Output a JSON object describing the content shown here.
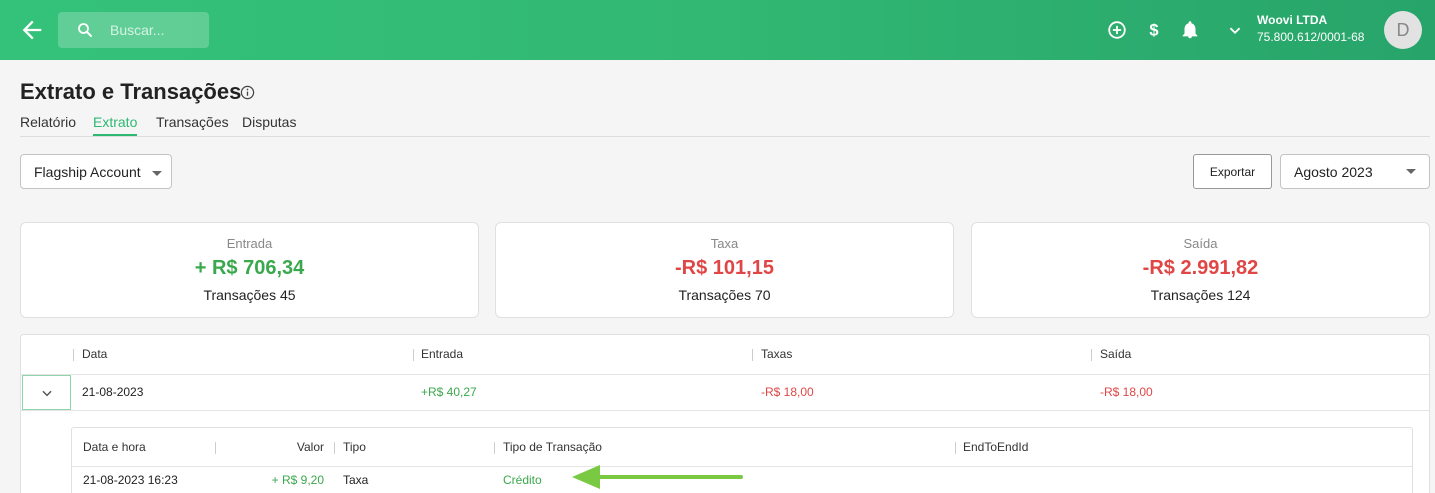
{
  "search": {
    "placeholder": "Buscar..."
  },
  "company": {
    "name": "Woovi LTDA",
    "cnpj": "75.800.612/0001-68"
  },
  "avatar": {
    "initial": "D"
  },
  "page": {
    "title": "Extrato e Transações"
  },
  "tabs": [
    {
      "label": "Relatório"
    },
    {
      "label": "Extrato"
    },
    {
      "label": "Transações"
    },
    {
      "label": "Disputas"
    }
  ],
  "account_select": {
    "value": "Flagship Account"
  },
  "export_label": "Exportar",
  "period_select": {
    "value": "Agosto 2023"
  },
  "summary": {
    "entrada": {
      "title": "Entrada",
      "value": "+ R$ 706,34",
      "count": "Transações 45"
    },
    "taxa": {
      "title": "Taxa",
      "value": "-R$ 101,15",
      "count": "Transações 70"
    },
    "saida": {
      "title": "Saída",
      "value": "-R$ 2.991,82",
      "count": "Transações 124"
    }
  },
  "table": {
    "headers": {
      "data": "Data",
      "entrada": "Entrada",
      "taxas": "Taxas",
      "saida": "Saída"
    },
    "rows": [
      {
        "data": "21-08-2023",
        "entrada": "+R$ 40,27",
        "taxas": "-R$ 18,00",
        "saida": "-R$ 18,00"
      }
    ]
  },
  "subtable": {
    "headers": {
      "datetime": "Data e hora",
      "valor": "Valor",
      "tipo": "Tipo",
      "tipo_transacao": "Tipo de Transação",
      "endtoend": "EndToEndId"
    },
    "rows": [
      {
        "datetime": "21-08-2023 16:23",
        "valor": "+ R$ 9,20",
        "tipo": "Taxa",
        "tipo_transacao": "Crédito",
        "endtoend": ""
      }
    ]
  },
  "colors": {
    "brand": "#2eb872",
    "positive": "#3aa84c",
    "negative": "#e04646",
    "annotation_arrow": "#7ac943"
  },
  "icons": [
    "arrow-left-icon",
    "search-icon",
    "add-circle-icon",
    "dollar-icon",
    "bell-icon",
    "chevron-down-icon",
    "info-icon",
    "caret-down-icon"
  ]
}
